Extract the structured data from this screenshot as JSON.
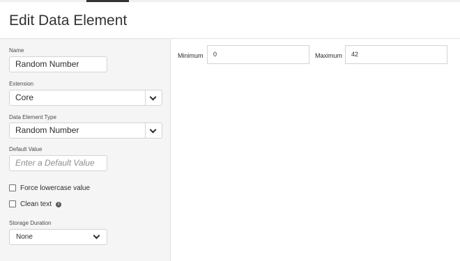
{
  "header": {
    "title": "Edit Data Element"
  },
  "sidebar": {
    "name": {
      "label": "Name",
      "value": "Random Number"
    },
    "extension": {
      "label": "Extension",
      "value": "Core"
    },
    "data_element_type": {
      "label": "Data Element Type",
      "value": "Random Number"
    },
    "default_value": {
      "label": "Default Value",
      "placeholder": "Enter a Default Value"
    },
    "force_lowercase": {
      "label": "Force lowercase value",
      "checked": false
    },
    "clean_text": {
      "label": "Clean text",
      "checked": false,
      "info_icon": "info-icon"
    },
    "storage_duration": {
      "label": "Storage Duration",
      "value": "None"
    }
  },
  "main": {
    "minimum": {
      "label": "Minimum",
      "value": "0"
    },
    "maximum": {
      "label": "Maximum",
      "value": "42"
    }
  }
}
